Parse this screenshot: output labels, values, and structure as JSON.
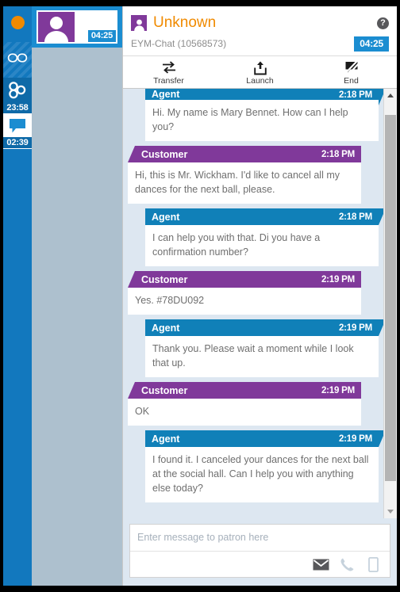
{
  "rail": {
    "items": [
      {
        "name": "status-indicator",
        "icon": "orange-dot-icon",
        "time": ""
      },
      {
        "name": "links",
        "icon": "infinity-link-icon",
        "time": ""
      },
      {
        "name": "cases",
        "icon": "three-circles-icon",
        "time": "23:58"
      },
      {
        "name": "chat",
        "icon": "speech-bubble-icon",
        "time": "02:39"
      }
    ]
  },
  "interactions": {
    "cards": [
      {
        "avatar_icon": "person-icon",
        "timer": "04:25"
      }
    ]
  },
  "header": {
    "contact_icon": "person-badge-icon",
    "contact_name": "Unknown",
    "help_icon": "help-circle-icon",
    "help_glyph": "?",
    "channel": "EYM-Chat (10568573)",
    "timer": "04:25"
  },
  "toolbar": {
    "items": [
      {
        "label": "Transfer",
        "icon": "transfer-arrows-icon"
      },
      {
        "label": "Launch",
        "icon": "launch-upload-icon"
      },
      {
        "label": "End",
        "icon": "end-chat-icon"
      }
    ]
  },
  "messages": [
    {
      "who": "Agent",
      "role": "agent",
      "time": "2:18 PM",
      "text": "Hi. My name is Mary Bennet. How can I help you?",
      "clipped": true
    },
    {
      "who": "Customer",
      "role": "customer",
      "time": "2:18 PM",
      "text": "Hi, this is Mr. Wickham. I'd like to cancel all my dances for the next ball, please.",
      "clipped": false
    },
    {
      "who": "Agent",
      "role": "agent",
      "time": "2:18 PM",
      "text": "I can help you with that. Di you have a confirmation number?",
      "clipped": false
    },
    {
      "who": "Customer",
      "role": "customer",
      "time": "2:19 PM",
      "text": "Yes. #78DU092",
      "clipped": false
    },
    {
      "who": "Agent",
      "role": "agent",
      "time": "2:19 PM",
      "text": "Thank you. Please wait a moment while I look that up.",
      "clipped": false
    },
    {
      "who": "Customer",
      "role": "customer",
      "time": "2:19 PM",
      "text": "OK",
      "clipped": false
    },
    {
      "who": "Agent",
      "role": "agent",
      "time": "2:19 PM",
      "text": "I found it. I canceled your dances for the next ball at the social hall. Can I help you with anything else today?",
      "clipped": false
    }
  ],
  "composer": {
    "placeholder": "Enter message to patron here",
    "value": "",
    "actions": [
      {
        "name": "email-icon",
        "active": true
      },
      {
        "name": "phone-icon",
        "active": false
      },
      {
        "name": "mobile-icon",
        "active": false
      }
    ]
  },
  "colors": {
    "agent_blue": "#1080b8",
    "customer_purple": "#80399a",
    "accent_orange": "#f08a00",
    "rail_blue": "#1278be",
    "chat_bg": "#dde7f1"
  }
}
